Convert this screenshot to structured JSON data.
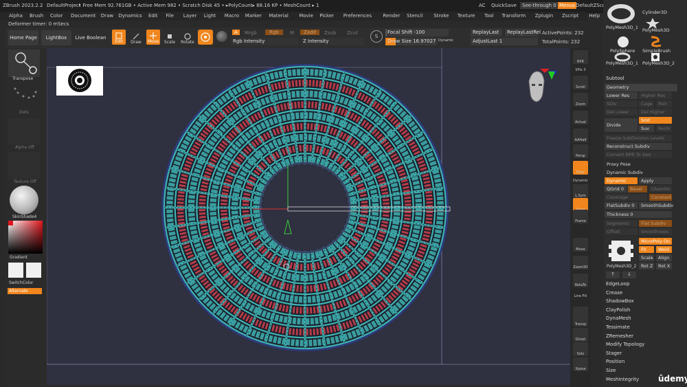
{
  "titlebar": {
    "app": "ZBrush 2023.2.2",
    "project": "DefaultProject",
    "stats": "• Free Mem 92.761GB • Active Mem 982 • Scratch Disk 45 • ▸PolyCount▸ 88.16 KP • MeshCount ▸ 1",
    "ac": "AC",
    "quicksave": "QuickSave",
    "seethrough": "See-through  0",
    "menus": "Menus",
    "zscript": "DefaultZScript"
  },
  "menus": [
    "Alpha",
    "Brush",
    "Color",
    "Document",
    "Draw",
    "Dynamics",
    "Edit",
    "File",
    "Layer",
    "Light",
    "Macro",
    "Marker",
    "Material",
    "Movie",
    "Picker",
    "Preferences",
    "Render",
    "Stencil",
    "Stroke",
    "Texture",
    "Tool",
    "Transform",
    "Zplugin",
    "Zscript",
    "Help"
  ],
  "message": "Deformer timer: 0 mSecs",
  "toolbar": {
    "home": "Home Page",
    "lightbox": "LightBox",
    "liveboolean": "Live Boolean",
    "edit": "Edit",
    "draw": "Draw",
    "move": "Move",
    "scale": "Scale",
    "rotate": "Rotate",
    "a_btn": "A",
    "mrgb": "Mrgb",
    "rgb": "Rgb",
    "m": "M",
    "zadd": "Zadd",
    "zsub": "Zsub",
    "zcut": "Zcut",
    "rgb_intensity": "Rgb Intensity",
    "z_intensity": "Z Intensity",
    "focal_shift": "Focal Shift -100",
    "draw_size": "Draw Size 16.97027",
    "dynamic": "Dynamic",
    "replaylast": "ReplayLast",
    "replaylastrel": "ReplayLastRel",
    "adjustlast": "AdjustLast  1",
    "active_points": "ActivePoints: 232",
    "total_points": "TotalPoints: 232"
  },
  "leftpanel": {
    "transpose": "Transpose",
    "dots": "Dots",
    "alpha_off": "Alpha Off",
    "texture_off": "Texture Off",
    "material": "SkinShade4",
    "gradient": "Gradient",
    "switchcolor": "SwitchColor",
    "alternate": "Alternate"
  },
  "shelf": [
    "BPR",
    "SPix 3",
    "Scroll",
    "Zoom",
    "Actual",
    "AAHalf",
    "Persp",
    "Floor",
    "Dynamic",
    "L.Sym",
    "Gxyz",
    "Frame",
    "Move",
    "Zoom3D",
    "RotaTe",
    "Line Fill",
    "PolyF",
    "Transp",
    "Ghost",
    "Solo",
    "Xpose"
  ],
  "rightpanel": {
    "tools": [
      "PolyMesh3D_1",
      "Cylinder3D",
      "PolyMesh3D",
      "PolySphere",
      "SimpleBrush",
      "PolyMesh3D_1",
      "PolyMesh3D_2"
    ],
    "subtool": "Subtool",
    "geometry": "Geometry",
    "lower_res": "Lower Res",
    "higher_res": "Higher Res",
    "sdiv": "SDiv",
    "cage": "Cage",
    "rstr": "Rstr",
    "del_lower": "Del Lower",
    "del_higher": "Del Higher",
    "divide": "Divide",
    "smt": "Smt",
    "suv": "Suv",
    "reuv": "ReUV",
    "freeze": "Freeze SubDivision Levels",
    "reconstruct": "Reconstruct Subdiv",
    "convert_bpr": "Convert BPR To Geo",
    "proxy_pose": "Proxy Pose",
    "dynamic_subdiv": "Dynamic Subdiv",
    "dynamic": "Dynamic",
    "apply": "Apply",
    "qgrid": "QGrid 0",
    "bevel": "Bevel",
    "chamfer": "Chamfer",
    "coverage": "Coverage",
    "constant": "Constant",
    "flatsubdiv": "FlatSubdiv 0",
    "smoothsubdiv": "SmoothSubdiv",
    "thickness": "Thickness 0",
    "segments": "Segments",
    "flatsubdivbtn": "Flat Subdiv",
    "offset": "Offset",
    "smoothness": "Smoothness",
    "micropoly": "MicroPoly On",
    "fit": "Fit",
    "weld": "Weld",
    "mp_name": "PolyMesh3D_2",
    "scale": "Scale",
    "align": "Align",
    "rotz": "Rot Z",
    "rotx": "Rot X",
    "sections": [
      "EdgeLoop",
      "Crease",
      "ShadowBox",
      "ClayPolish",
      "DynaMesh",
      "Tessimate",
      "ZRemesher",
      "Modify Topology",
      "Stager",
      "Position",
      "Size",
      "MeshIntegrity"
    ]
  },
  "viewport": {
    "rings": 9,
    "spokes": 44,
    "colors": {
      "background": "#2f3040",
      "cyan": "#3fb3b3",
      "red": "#d2424f",
      "dark": "#1a1f2a",
      "orange": "#f0861d"
    }
  },
  "watermark": "ûdemy"
}
